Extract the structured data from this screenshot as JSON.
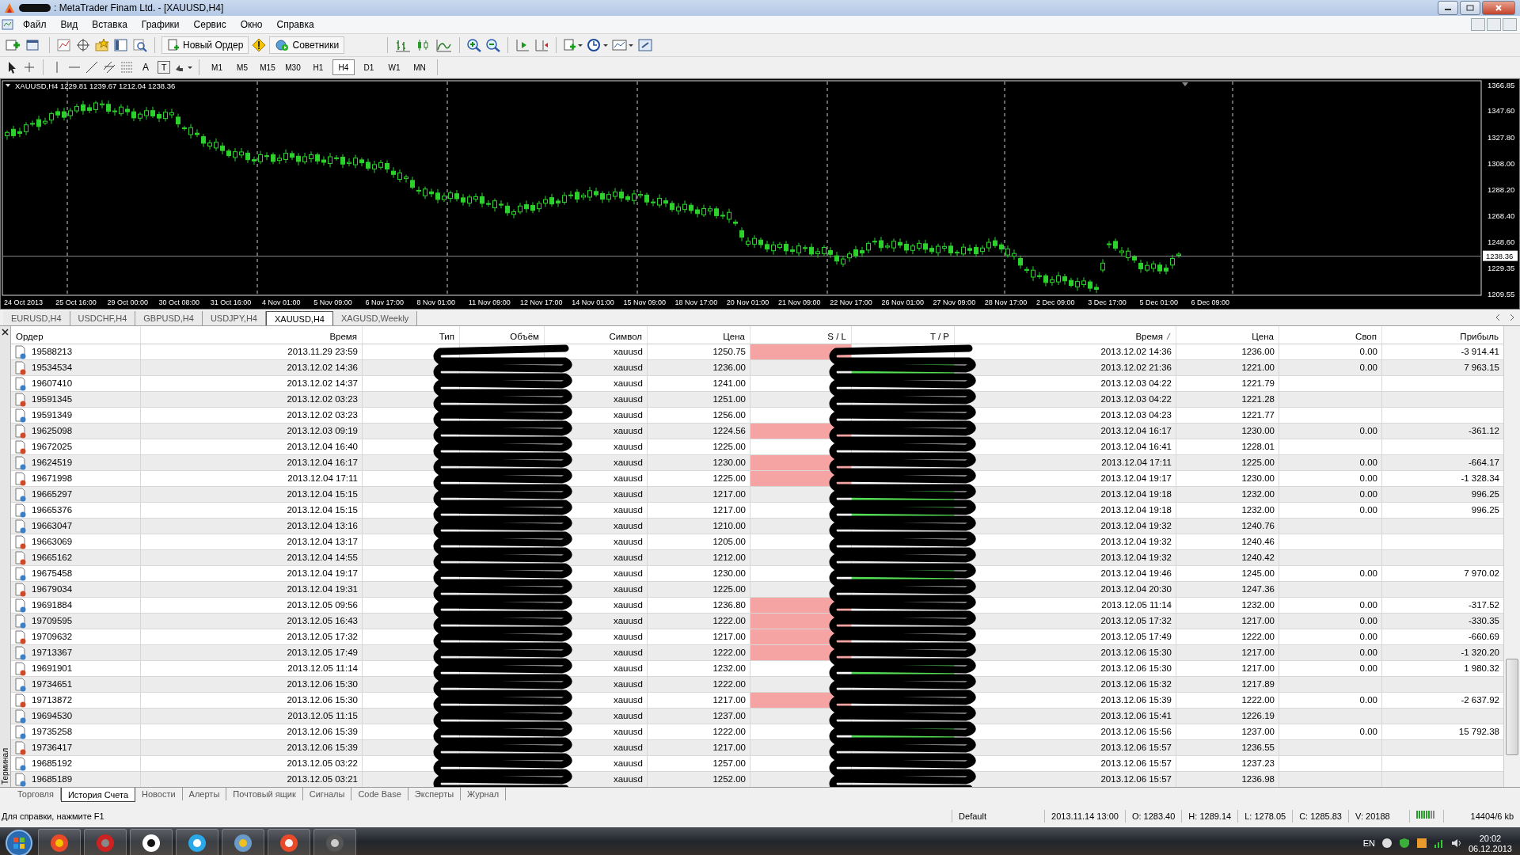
{
  "window": {
    "title": ": MetaTrader Finam Ltd. - [XAUUSD,H4]"
  },
  "menu": [
    "Файл",
    "Вид",
    "Вставка",
    "Графики",
    "Сервис",
    "Окно",
    "Справка"
  ],
  "toolbar": {
    "new_order": "Новый Ордер",
    "experts": "Советники",
    "text_tool": "A",
    "label_tool": "T"
  },
  "timeframes": [
    {
      "label": "M1",
      "selected": false
    },
    {
      "label": "M5",
      "selected": false
    },
    {
      "label": "M15",
      "selected": false
    },
    {
      "label": "M30",
      "selected": false
    },
    {
      "label": "H1",
      "selected": false
    },
    {
      "label": "H4",
      "selected": true
    },
    {
      "label": "D1",
      "selected": false
    },
    {
      "label": "W1",
      "selected": false
    },
    {
      "label": "MN",
      "selected": false
    }
  ],
  "chart": {
    "header": "XAUUSD,H4  1229.81 1239.67 1212.04 1238.36",
    "current_price": "1238.36",
    "price_ticks": [
      "1366.85",
      "1347.60",
      "1327.80",
      "1308.00",
      "1288.20",
      "1268.40",
      "1248.60",
      "1229.35",
      "1209.55"
    ],
    "date_labels": [
      "24 Oct 2013",
      "25 Oct 16:00",
      "29 Oct 00:00",
      "30 Oct 08:00",
      "31 Oct 16:00",
      "4 Nov 01:00",
      "5 Nov 09:00",
      "6 Nov 17:00",
      "8 Nov 01:00",
      "11 Nov 09:00",
      "12 Nov 17:00",
      "14 Nov 01:00",
      "15 Nov 09:00",
      "18 Nov 17:00",
      "20 Nov 01:00",
      "21 Nov 09:00",
      "22 Nov 17:00",
      "26 Nov 01:00",
      "27 Nov 09:00",
      "28 Nov 17:00",
      "2 Dec 09:00",
      "3 Dec 17:00",
      "5 Dec 01:00",
      "6 Dec 09:00"
    ]
  },
  "chart_tabs": [
    {
      "label": "EURUSD,H4",
      "selected": false
    },
    {
      "label": "USDCHF,H4",
      "selected": false
    },
    {
      "label": "GBPUSD,H4",
      "selected": false
    },
    {
      "label": "USDJPY,H4",
      "selected": false
    },
    {
      "label": "XAUUSD,H4",
      "selected": true
    },
    {
      "label": "XAGUSD,Weekly",
      "selected": false
    }
  ],
  "table": {
    "columns": [
      "Ордер",
      "Время",
      "Тип",
      "Объём",
      "Символ",
      "Цена",
      "S / L",
      "T / P",
      "Время",
      "Цена",
      "Своп",
      "Прибыль"
    ],
    "rows": [
      {
        "order": "19588213",
        "open_time": "2013.11.29 23:59",
        "symbol": "xauusd",
        "open_price": "1250.75",
        "close_time": "2013.12.02 14:36",
        "close_price": "1236.00",
        "swap": "0.00",
        "profit": "-3 914.41",
        "color": "#3a7fc8",
        "sl_hit": true,
        "tp_hit": false
      },
      {
        "order": "19534534",
        "open_time": "2013.12.02 14:36",
        "symbol": "xauusd",
        "open_price": "1236.00",
        "close_time": "2013.12.02 21:36",
        "close_price": "1221.00",
        "swap": "0.00",
        "profit": "7 963.15",
        "color": "#d04a2a",
        "sl_hit": false,
        "tp_hit": true
      },
      {
        "order": "19607410",
        "open_time": "2013.12.02 14:37",
        "symbol": "xauusd",
        "open_price": "1241.00",
        "close_time": "2013.12.03 04:22",
        "close_price": "1221.79",
        "color": "#3a7fc8",
        "sl_hit": false,
        "tp_hit": false
      },
      {
        "order": "19591345",
        "open_time": "2013.12.02 03:23",
        "symbol": "xauusd",
        "open_price": "1251.00",
        "close_time": "2013.12.03 04:22",
        "close_price": "1221.28",
        "color": "#d04a2a",
        "sl_hit": false,
        "tp_hit": false
      },
      {
        "order": "19591349",
        "open_time": "2013.12.02 03:23",
        "symbol": "xauusd",
        "open_price": "1256.00",
        "close_time": "2013.12.03 04:23",
        "close_price": "1221.77",
        "color": "#3a7fc8",
        "sl_hit": false,
        "tp_hit": false
      },
      {
        "order": "19625098",
        "open_time": "2013.12.03 09:19",
        "symbol": "xauusd",
        "open_price": "1224.56",
        "close_time": "2013.12.04 16:17",
        "close_price": "1230.00",
        "swap": "0.00",
        "profit": "-361.12",
        "color": "#d04a2a",
        "sl_hit": true,
        "tp_hit": false
      },
      {
        "order": "19672025",
        "open_time": "2013.12.04 16:40",
        "symbol": "xauusd",
        "open_price": "1225.00",
        "close_time": "2013.12.04 16:41",
        "close_price": "1228.01",
        "color": "#d04a2a",
        "sl_hit": false,
        "tp_hit": false
      },
      {
        "order": "19624519",
        "open_time": "2013.12.04 16:17",
        "symbol": "xauusd",
        "open_price": "1230.00",
        "close_time": "2013.12.04 17:11",
        "close_price": "1225.00",
        "swap": "0.00",
        "profit": "-664.17",
        "color": "#3a7fc8",
        "sl_hit": true,
        "tp_hit": false
      },
      {
        "order": "19671998",
        "open_time": "2013.12.04 17:11",
        "symbol": "xauusd",
        "open_price": "1225.00",
        "close_time": "2013.12.04 19:17",
        "close_price": "1230.00",
        "swap": "0.00",
        "profit": "-1 328.34",
        "color": "#d04a2a",
        "sl_hit": true,
        "tp_hit": false
      },
      {
        "order": "19665297",
        "open_time": "2013.12.04 15:15",
        "symbol": "xauusd",
        "open_price": "1217.00",
        "close_time": "2013.12.04 19:18",
        "close_price": "1232.00",
        "swap": "0.00",
        "profit": "996.25",
        "color": "#3a7fc8",
        "sl_hit": false,
        "tp_hit": true
      },
      {
        "order": "19665376",
        "open_time": "2013.12.04 15:15",
        "symbol": "xauusd",
        "open_price": "1217.00",
        "close_time": "2013.12.04 19:18",
        "close_price": "1232.00",
        "swap": "0.00",
        "profit": "996.25",
        "color": "#3a7fc8",
        "sl_hit": false,
        "tp_hit": true
      },
      {
        "order": "19663047",
        "open_time": "2013.12.04 13:16",
        "symbol": "xauusd",
        "open_price": "1210.00",
        "close_time": "2013.12.04 19:32",
        "close_price": "1240.76",
        "color": "#3a7fc8",
        "sl_hit": false,
        "tp_hit": false
      },
      {
        "order": "19663069",
        "open_time": "2013.12.04 13:17",
        "symbol": "xauusd",
        "open_price": "1205.00",
        "close_time": "2013.12.04 19:32",
        "close_price": "1240.46",
        "color": "#d04a2a",
        "sl_hit": false,
        "tp_hit": false
      },
      {
        "order": "19665162",
        "open_time": "2013.12.04 14:55",
        "symbol": "xauusd",
        "open_price": "1212.00",
        "close_time": "2013.12.04 19:32",
        "close_price": "1240.42",
        "color": "#d04a2a",
        "sl_hit": false,
        "tp_hit": false
      },
      {
        "order": "19675458",
        "open_time": "2013.12.04 19:17",
        "symbol": "xauusd",
        "open_price": "1230.00",
        "close_time": "2013.12.04 19:46",
        "close_price": "1245.00",
        "swap": "0.00",
        "profit": "7 970.02",
        "color": "#3a7fc8",
        "sl_hit": false,
        "tp_hit": true
      },
      {
        "order": "19679034",
        "open_time": "2013.12.04 19:31",
        "symbol": "xauusd",
        "open_price": "1225.00",
        "close_time": "2013.12.04 20:30",
        "close_price": "1247.36",
        "color": "#d04a2a",
        "sl_hit": false,
        "tp_hit": false
      },
      {
        "order": "19691884",
        "open_time": "2013.12.05 09:56",
        "symbol": "xauusd",
        "open_price": "1236.80",
        "close_time": "2013.12.05 11:14",
        "close_price": "1232.00",
        "swap": "0.00",
        "profit": "-317.52",
        "color": "#3a7fc8",
        "sl_hit": true,
        "tp_hit": false
      },
      {
        "order": "19709595",
        "open_time": "2013.12.05 16:43",
        "symbol": "xauusd",
        "open_price": "1222.00",
        "close_time": "2013.12.05 17:32",
        "close_price": "1217.00",
        "swap": "0.00",
        "profit": "-330.35",
        "color": "#3a7fc8",
        "sl_hit": true,
        "tp_hit": false
      },
      {
        "order": "19709632",
        "open_time": "2013.12.05 17:32",
        "symbol": "xauusd",
        "open_price": "1217.00",
        "close_time": "2013.12.05 17:49",
        "close_price": "1222.00",
        "swap": "0.00",
        "profit": "-660.69",
        "color": "#d04a2a",
        "sl_hit": true,
        "tp_hit": false
      },
      {
        "order": "19713367",
        "open_time": "2013.12.05 17:49",
        "symbol": "xauusd",
        "open_price": "1222.00",
        "close_time": "2013.12.06 15:30",
        "close_price": "1217.00",
        "swap": "0.00",
        "profit": "-1 320.20",
        "color": "#3a7fc8",
        "sl_hit": true,
        "tp_hit": false
      },
      {
        "order": "19691901",
        "open_time": "2013.12.05 11:14",
        "symbol": "xauusd",
        "open_price": "1232.00",
        "close_time": "2013.12.06 15:30",
        "close_price": "1217.00",
        "swap": "0.00",
        "profit": "1 980.32",
        "color": "#d04a2a",
        "sl_hit": false,
        "tp_hit": true
      },
      {
        "order": "19734651",
        "open_time": "2013.12.06 15:30",
        "symbol": "xauusd",
        "open_price": "1222.00",
        "close_time": "2013.12.06 15:32",
        "close_price": "1217.89",
        "color": "#3a7fc8",
        "sl_hit": false,
        "tp_hit": false
      },
      {
        "order": "19713872",
        "open_time": "2013.12.06 15:30",
        "symbol": "xauusd",
        "open_price": "1217.00",
        "close_time": "2013.12.06 15:39",
        "close_price": "1222.00",
        "swap": "0.00",
        "profit": "-2 637.92",
        "color": "#d04a2a",
        "sl_hit": true,
        "tp_hit": false
      },
      {
        "order": "19694530",
        "open_time": "2013.12.05 11:15",
        "symbol": "xauusd",
        "open_price": "1237.00",
        "close_time": "2013.12.06 15:41",
        "close_price": "1226.19",
        "color": "#3a7fc8",
        "sl_hit": false,
        "tp_hit": false
      },
      {
        "order": "19735258",
        "open_time": "2013.12.06 15:39",
        "symbol": "xauusd",
        "open_price": "1222.00",
        "close_time": "2013.12.06 15:56",
        "close_price": "1237.00",
        "swap": "0.00",
        "profit": "15 792.38",
        "color": "#3a7fc8",
        "sl_hit": false,
        "tp_hit": true
      },
      {
        "order": "19736417",
        "open_time": "2013.12.06 15:39",
        "symbol": "xauusd",
        "open_price": "1217.00",
        "close_time": "2013.12.06 15:57",
        "close_price": "1236.55",
        "color": "#d04a2a",
        "sl_hit": false,
        "tp_hit": false
      },
      {
        "order": "19685192",
        "open_time": "2013.12.05 03:22",
        "symbol": "xauusd",
        "open_price": "1257.00",
        "close_time": "2013.12.06 15:57",
        "close_price": "1237.23",
        "color": "#3a7fc8",
        "sl_hit": false,
        "tp_hit": false
      },
      {
        "order": "19685189",
        "open_time": "2013.12.05 03:21",
        "symbol": "xauusd",
        "open_price": "1252.00",
        "close_time": "2013.12.06 15:57",
        "close_price": "1236.98",
        "color": "#3a7fc8",
        "sl_hit": false,
        "tp_hit": false
      }
    ]
  },
  "side_label": "Терминал",
  "terminal_tabs": [
    {
      "label": "Торговля",
      "selected": false
    },
    {
      "label": "История Счета",
      "selected": true
    },
    {
      "label": "Новости",
      "selected": false
    },
    {
      "label": "Алерты",
      "selected": false
    },
    {
      "label": "Почтовый ящик",
      "selected": false
    },
    {
      "label": "Сигналы",
      "selected": false
    },
    {
      "label": "Code Base",
      "selected": false
    },
    {
      "label": "Эксперты",
      "selected": false
    },
    {
      "label": "Журнал",
      "selected": false
    }
  ],
  "status_bar": {
    "help": "Для справки, нажмите F1",
    "profile": "Default",
    "time": "2013.11.14 13:00",
    "open": "O: 1283.40",
    "high": "H: 1289.14",
    "low": "L: 1278.05",
    "close": "C: 1285.83",
    "volume": "V: 20188",
    "traffic": "14404/6 kb"
  },
  "taskbar": {
    "language": "EN",
    "time": "20:02",
    "date": "06.12.2013"
  }
}
